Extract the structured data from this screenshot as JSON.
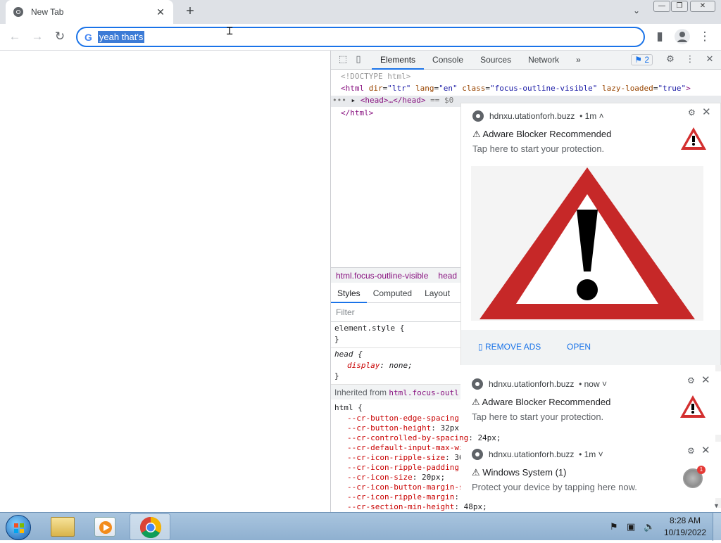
{
  "browser": {
    "tab_title": "New Tab",
    "tab_close": "✕",
    "new_tab": "+",
    "tab_search": "⌄",
    "omnibox_value": "yeah that's",
    "omnibox_engine": "G"
  },
  "window_controls": {
    "minimize": "—",
    "restore": "❐",
    "close": "✕"
  },
  "devtools": {
    "tabs": [
      "Elements",
      "Console",
      "Sources",
      "Network"
    ],
    "more_tabs": "»",
    "issues_count": "2",
    "dom": {
      "doctype": "<!DOCTYPE html>",
      "html_open_tag": "<html",
      "html_attr1_name": "dir",
      "html_attr1_value": "\"ltr\"",
      "html_attr2_name": "lang",
      "html_attr2_value": "\"en\"",
      "html_attr3_name": "class",
      "html_attr3_value": "\"focus-outline-visible\"",
      "html_attr4_name": "lazy-loaded",
      "html_attr4_value": "\"true\"",
      "html_close_bracket": ">",
      "head_line": "<head>…</head>",
      "head_selected_marker": "== $0",
      "html_close": "</html>",
      "ellipsis": "•••"
    },
    "breadcrumbs": [
      "html.focus-outline-visible",
      "head"
    ],
    "styles_tabs": [
      "Styles",
      "Computed",
      "Layout"
    ],
    "filter_placeholder": "Filter",
    "element_style_open": "element.style {",
    "brace_close": "}",
    "head_rule_open": "head {",
    "head_prop_name": "display",
    "head_prop_value": "none;",
    "inherited_label": "Inherited from",
    "inherited_selector": "html.focus-outl",
    "html_rule_open": "html {",
    "css_vars": [
      {
        "name": "--cr-button-edge-spacing",
        "value": ""
      },
      {
        "name": "--cr-button-height",
        "value": "32px"
      },
      {
        "name": "--cr-controlled-by-spacing",
        "value": "24px;"
      },
      {
        "name": "--cr-default-input-max-wi",
        "value": ""
      },
      {
        "name": "--cr-icon-ripple-size",
        "value": "36"
      },
      {
        "name": "--cr-icon-ripple-padding",
        "value": ""
      },
      {
        "name": "--cr-icon-size",
        "value": "20px;"
      },
      {
        "name": "--cr-icon-button-margin-s",
        "value": ""
      },
      {
        "name": "--cr-icon-ripple-margin",
        "value": ""
      },
      {
        "name": "--cr-section-min-height",
        "value": "48px;"
      }
    ]
  },
  "notifications": [
    {
      "source": "hdnxu.utationforh.buzz",
      "time": "• 1m ˄",
      "title": "⚠ Adware Blocker Recommended",
      "message": "Tap here to start your protection.",
      "actions": [
        "REMOVE ADS",
        "OPEN"
      ]
    },
    {
      "source": "hdnxu.utationforh.buzz",
      "time": "• now ˅",
      "title": "⚠ Adware Blocker Recommended",
      "message": "Tap here to start your protection."
    },
    {
      "source": "hdnxu.utationforh.buzz",
      "time": "• 1m ˅",
      "title": "⚠ Windows System (1)",
      "message": "Protect your device by tapping here now.",
      "badge": "1"
    }
  ],
  "taskbar": {
    "time": "8:28 AM",
    "date": "10/19/2022"
  },
  "colors": {
    "accent": "#1a73e8",
    "warning_red": "#d32f2f",
    "taskbar": "#a9c5df"
  }
}
